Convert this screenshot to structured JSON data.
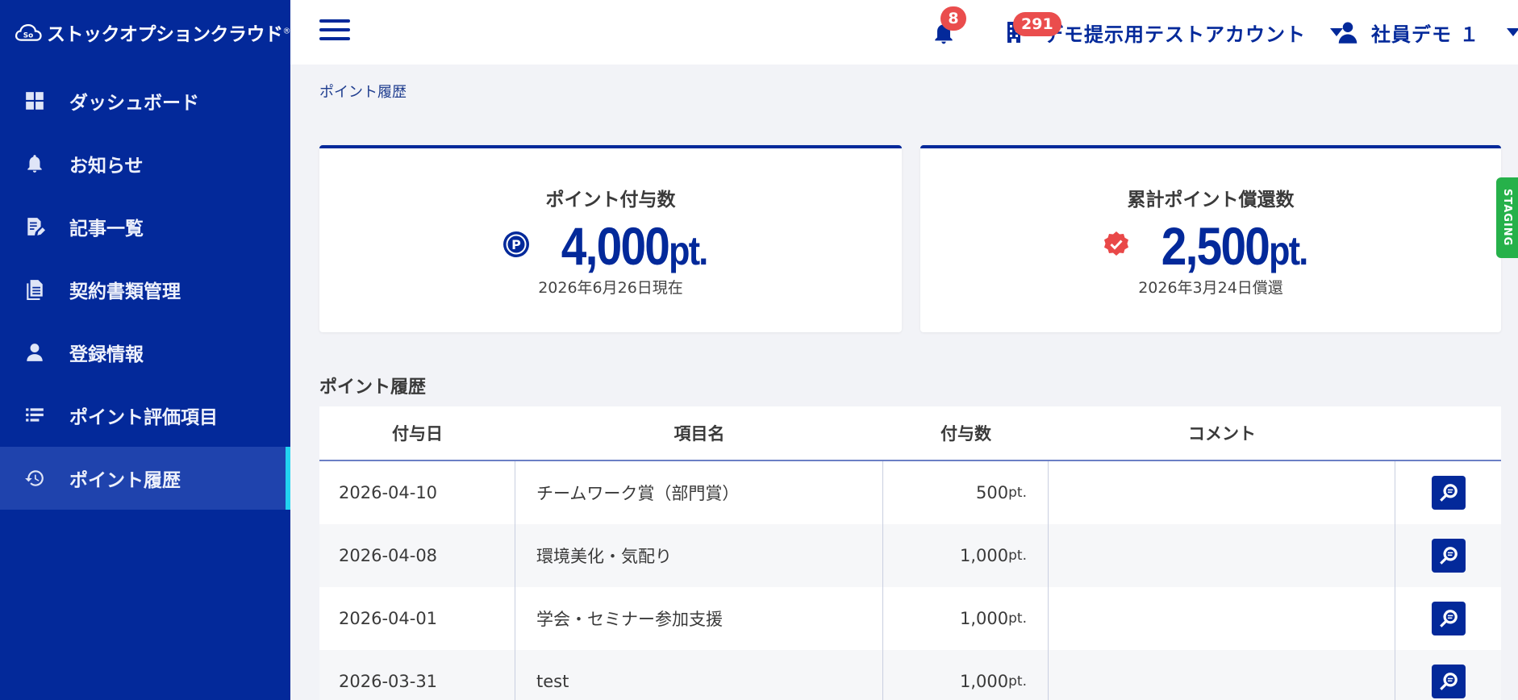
{
  "brand": {
    "logo_text": "So",
    "name": "ストックオプションクラウド",
    "mark": "®"
  },
  "sidebar": {
    "items": [
      {
        "label": "ダッシュボード",
        "icon": "dashboard-icon"
      },
      {
        "label": "お知らせ",
        "icon": "bell-icon"
      },
      {
        "label": "記事一覧",
        "icon": "article-icon"
      },
      {
        "label": "契約書類管理",
        "icon": "document-icon"
      },
      {
        "label": "登録情報",
        "icon": "person-icon"
      },
      {
        "label": "ポイント評価項目",
        "icon": "list-icon"
      },
      {
        "label": "ポイント履歴",
        "icon": "history-icon",
        "active": true
      }
    ]
  },
  "header": {
    "notification_count": "8",
    "company_badge": "291",
    "company_name": "デモ提示用テストアカウント",
    "user_name": "社員デモ １"
  },
  "breadcrumb": "ポイント履歴",
  "cards": {
    "granted": {
      "title": "ポイント付与数",
      "value": "4,000",
      "unit": "pt.",
      "sub": "2026年6月26日現在",
      "icon": "point-icon"
    },
    "redeemed": {
      "title": "累計ポイント償還数",
      "value": "2,500",
      "unit": "pt.",
      "sub": "2026年3月24日償還",
      "icon": "verified-badge-icon"
    }
  },
  "history": {
    "title": "ポイント履歴",
    "columns": [
      "付与日",
      "項目名",
      "付与数",
      "コメント",
      ""
    ],
    "rows": [
      {
        "date": "2026-04-10",
        "item": "チームワーク賞（部門賞）",
        "amount": "500",
        "unit": "pt.",
        "comment": ""
      },
      {
        "date": "2026-04-08",
        "item": "環境美化・気配り",
        "amount": "1,000",
        "unit": "pt.",
        "comment": ""
      },
      {
        "date": "2026-04-01",
        "item": "学会・セミナー参加支援",
        "amount": "1,000",
        "unit": "pt.",
        "comment": ""
      },
      {
        "date": "2026-03-31",
        "item": "test",
        "amount": "1,000",
        "unit": "pt.",
        "comment": ""
      }
    ]
  },
  "staging_label": "STAGING",
  "colors": {
    "primary": "#03299a",
    "accent": "#22d3f0",
    "badge": "#ea4d4d",
    "staging": "#26b14a"
  }
}
